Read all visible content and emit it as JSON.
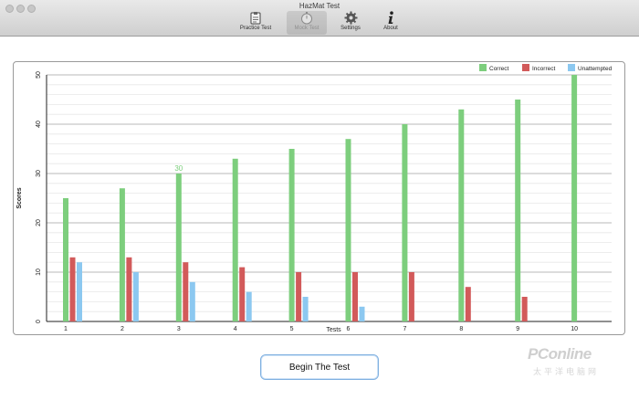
{
  "window": {
    "title": "HazMat Test"
  },
  "toolbar": {
    "items": [
      {
        "label": "Practice Test",
        "icon": "clipboard-icon"
      },
      {
        "label": "Mock Test",
        "icon": "stopwatch-icon",
        "state": "disabled"
      },
      {
        "label": "Settings",
        "icon": "gear-icon"
      },
      {
        "label": "About",
        "icon": "info-icon"
      }
    ]
  },
  "chart_data": {
    "type": "bar",
    "title": "",
    "xlabel": "Tests",
    "ylabel": "Scores",
    "ylim": [
      0,
      50
    ],
    "yticks": [
      0,
      10,
      20,
      30,
      40,
      50
    ],
    "categories": [
      "1",
      "2",
      "3",
      "4",
      "5",
      "6",
      "7",
      "8",
      "9",
      "10"
    ],
    "series": [
      {
        "name": "Correct",
        "color": "#7dce7d",
        "values": [
          25,
          27,
          30,
          33,
          35,
          37,
          40,
          43,
          45,
          50
        ]
      },
      {
        "name": "Incorrect",
        "color": "#d25a5a",
        "values": [
          13,
          13,
          12,
          11,
          10,
          10,
          10,
          7,
          5,
          0
        ]
      },
      {
        "name": "Unattempted",
        "color": "#8cc8f0",
        "values": [
          12,
          10,
          8,
          6,
          5,
          3,
          0,
          0,
          0,
          0
        ]
      }
    ],
    "annotations": [
      {
        "text": "30",
        "category": "3",
        "series": "Correct"
      }
    ],
    "grid": true,
    "legend_position": "top-right"
  },
  "actions": {
    "begin_label": "Begin The Test"
  },
  "watermark": {
    "main": "PConline",
    "sub": "太平洋电脑网"
  }
}
